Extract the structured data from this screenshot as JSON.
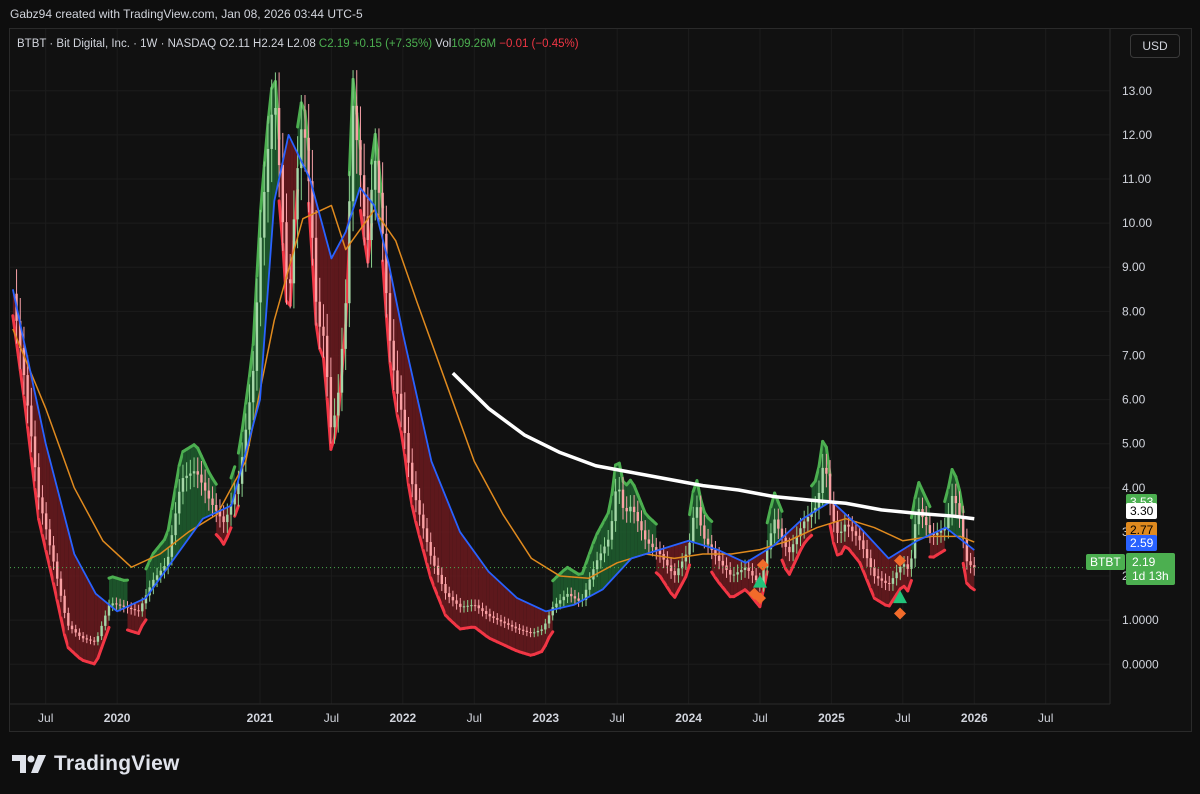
{
  "header": {
    "attribution": "Gabz94 created with TradingView.com, Jan 08, 2026 03:44 UTC-5"
  },
  "legend": {
    "symbol": "BTBT · Bit Digital, Inc. · 1W · NASDAQ",
    "open": "O2.11",
    "high": "H2.24",
    "low": "L2.08",
    "close": "C2.19",
    "change": "+0.15 (+7.35%)",
    "volume_label": "Vol",
    "volume": "109.26M",
    "volume_change": "−0.01 (−0.45%)"
  },
  "toolbar": {
    "currency_label": "USD"
  },
  "price_tags": {
    "tag_green": "3.53",
    "tag_white": "3.30",
    "tag_orange": "2.77",
    "tag_blue": "2.59",
    "tag_last": "2.19",
    "tag_countdown": "1d 13h",
    "symbol_tag": "BTBT"
  },
  "footer": {
    "logo_text": "TradingView"
  },
  "colors": {
    "up": "#4caf50",
    "down": "#f23645",
    "ma_fast": "#2962ff",
    "ma_slow": "#e08a1e",
    "ma_long": "#ffffff",
    "cloud_bull": "#1f5f2f",
    "cloud_bear": "#6b1a1f"
  },
  "chart_data": {
    "type": "line",
    "title": "BTBT · Bit Digital, Inc. · 1W · NASDAQ",
    "y_ticks": [
      "13.00",
      "12.00",
      "11.00",
      "10.00",
      "9.00",
      "8.00",
      "7.00",
      "6.00",
      "5.00",
      "4.00",
      "3.00",
      "2.00",
      "1.0000",
      "0.0000"
    ],
    "y_tick_values": [
      13,
      12,
      11,
      10,
      9,
      8,
      7,
      6,
      5,
      4,
      3,
      2,
      1,
      0
    ],
    "ylim": [
      -0.9,
      14.4
    ],
    "x_ticks": [
      "Jul",
      "2020",
      "2021",
      "Jul",
      "2022",
      "Jul",
      "2023",
      "Jul",
      "2024",
      "Jul",
      "2025",
      "Jul",
      "2026",
      "Jul"
    ],
    "x_tick_values": [
      2019.5,
      2020.0,
      2021.0,
      2021.5,
      2022.0,
      2022.5,
      2023.0,
      2023.5,
      2024.0,
      2024.5,
      2025.0,
      2025.5,
      2026.0,
      2026.5
    ],
    "xlim": [
      2019.25,
      2026.95
    ],
    "grid": true,
    "series": [
      {
        "name": "BTBT",
        "x": [
          2019.27,
          2019.35,
          2019.45,
          2019.55,
          2019.65,
          2019.75,
          2019.85,
          2019.95,
          2020.05,
          2020.15,
          2020.25,
          2020.35,
          2020.45,
          2020.55,
          2020.65,
          2020.75,
          2020.85,
          2020.95,
          2021.0,
          2021.05,
          2021.1,
          2021.15,
          2021.2,
          2021.25,
          2021.3,
          2021.35,
          2021.4,
          2021.45,
          2021.5,
          2021.55,
          2021.6,
          2021.65,
          2021.7,
          2021.75,
          2021.8,
          2021.85,
          2021.9,
          2021.95,
          2022.0,
          2022.05,
          2022.1,
          2022.2,
          2022.3,
          2022.4,
          2022.5,
          2022.6,
          2022.7,
          2022.8,
          2022.9,
          2022.98,
          2023.05,
          2023.15,
          2023.25,
          2023.35,
          2023.45,
          2023.5,
          2023.55,
          2023.6,
          2023.7,
          2023.8,
          2023.9,
          2024.0,
          2024.05,
          2024.1,
          2024.2,
          2024.3,
          2024.4,
          2024.5,
          2024.55,
          2024.6,
          2024.7,
          2024.8,
          2024.9,
          2024.95,
          2025.0,
          2025.05,
          2025.1,
          2025.2,
          2025.3,
          2025.4,
          2025.5,
          2025.55,
          2025.6,
          2025.7,
          2025.8,
          2025.85,
          2025.9,
          2025.95,
          2026.0
        ],
        "values": [
          8.4,
          6.5,
          3.8,
          2.4,
          0.9,
          0.6,
          0.5,
          1.4,
          1.3,
          1.2,
          1.9,
          2.3,
          4.2,
          4.4,
          3.7,
          3.2,
          4.1,
          6.5,
          9.5,
          11.5,
          13.0,
          10.5,
          8.0,
          10.8,
          12.5,
          10.6,
          7.8,
          7.4,
          5.2,
          6.2,
          8.2,
          12.7,
          11.2,
          9.4,
          11.6,
          10.2,
          7.6,
          6.3,
          5.6,
          4.3,
          3.6,
          2.4,
          1.6,
          1.3,
          1.35,
          1.1,
          0.95,
          0.8,
          0.7,
          0.8,
          1.3,
          1.6,
          1.4,
          2.3,
          2.9,
          4.2,
          3.4,
          3.6,
          2.8,
          2.5,
          2.0,
          2.6,
          3.7,
          2.9,
          2.4,
          2.0,
          2.2,
          1.8,
          2.6,
          3.3,
          2.5,
          3.2,
          3.6,
          4.7,
          3.4,
          2.9,
          3.2,
          2.8,
          2.0,
          1.8,
          2.3,
          2.1,
          3.6,
          2.9,
          3.1,
          3.9,
          3.3,
          2.3,
          2.19
        ]
      },
      {
        "name": "MA fast",
        "x": [
          2019.27,
          2019.5,
          2019.7,
          2019.85,
          2020.0,
          2020.2,
          2020.4,
          2020.6,
          2020.8,
          2021.0,
          2021.1,
          2021.2,
          2021.35,
          2021.5,
          2021.6,
          2021.7,
          2021.8,
          2021.9,
          2022.0,
          2022.2,
          2022.4,
          2022.6,
          2022.8,
          2023.0,
          2023.2,
          2023.4,
          2023.6,
          2023.8,
          2024.0,
          2024.2,
          2024.4,
          2024.6,
          2024.8,
          2025.0,
          2025.2,
          2025.4,
          2025.6,
          2025.8,
          2026.0
        ],
        "values": [
          8.5,
          5.0,
          2.5,
          1.6,
          1.2,
          1.5,
          2.4,
          3.3,
          3.6,
          6.0,
          10.5,
          12.0,
          11.0,
          9.2,
          9.8,
          10.8,
          10.4,
          9.1,
          7.5,
          4.6,
          3.0,
          2.1,
          1.5,
          1.2,
          1.35,
          1.7,
          2.4,
          2.6,
          2.8,
          2.6,
          2.3,
          2.7,
          3.3,
          3.7,
          3.1,
          2.4,
          2.8,
          3.1,
          2.59
        ]
      },
      {
        "name": "MA slow",
        "x": [
          2019.27,
          2019.5,
          2019.7,
          2019.9,
          2020.1,
          2020.3,
          2020.5,
          2020.7,
          2020.9,
          2021.1,
          2021.3,
          2021.5,
          2021.6,
          2021.8,
          2021.95,
          2022.1,
          2022.3,
          2022.5,
          2022.7,
          2022.9,
          2023.1,
          2023.3,
          2023.5,
          2023.7,
          2023.9,
          2024.1,
          2024.3,
          2024.5,
          2024.7,
          2024.9,
          2025.1,
          2025.3,
          2025.5,
          2025.7,
          2025.9,
          2026.0
        ],
        "values": [
          7.6,
          5.8,
          4.0,
          2.8,
          2.2,
          2.5,
          3.0,
          3.4,
          4.6,
          7.8,
          10.1,
          10.4,
          9.4,
          10.3,
          9.6,
          8.2,
          6.4,
          4.6,
          3.4,
          2.4,
          2.0,
          1.95,
          2.3,
          2.5,
          2.4,
          2.5,
          2.5,
          2.6,
          2.8,
          3.1,
          3.3,
          3.1,
          2.8,
          2.9,
          2.9,
          2.77
        ]
      },
      {
        "name": "MA long",
        "x": [
          2022.35,
          2022.6,
          2022.85,
          2023.1,
          2023.35,
          2023.6,
          2023.85,
          2024.1,
          2024.35,
          2024.6,
          2024.85,
          2025.1,
          2025.35,
          2025.6,
          2025.85,
          2026.0
        ],
        "values": [
          6.6,
          5.8,
          5.2,
          4.8,
          4.5,
          4.35,
          4.2,
          4.05,
          3.95,
          3.8,
          3.72,
          3.65,
          3.5,
          3.42,
          3.36,
          3.3
        ]
      }
    ]
  }
}
